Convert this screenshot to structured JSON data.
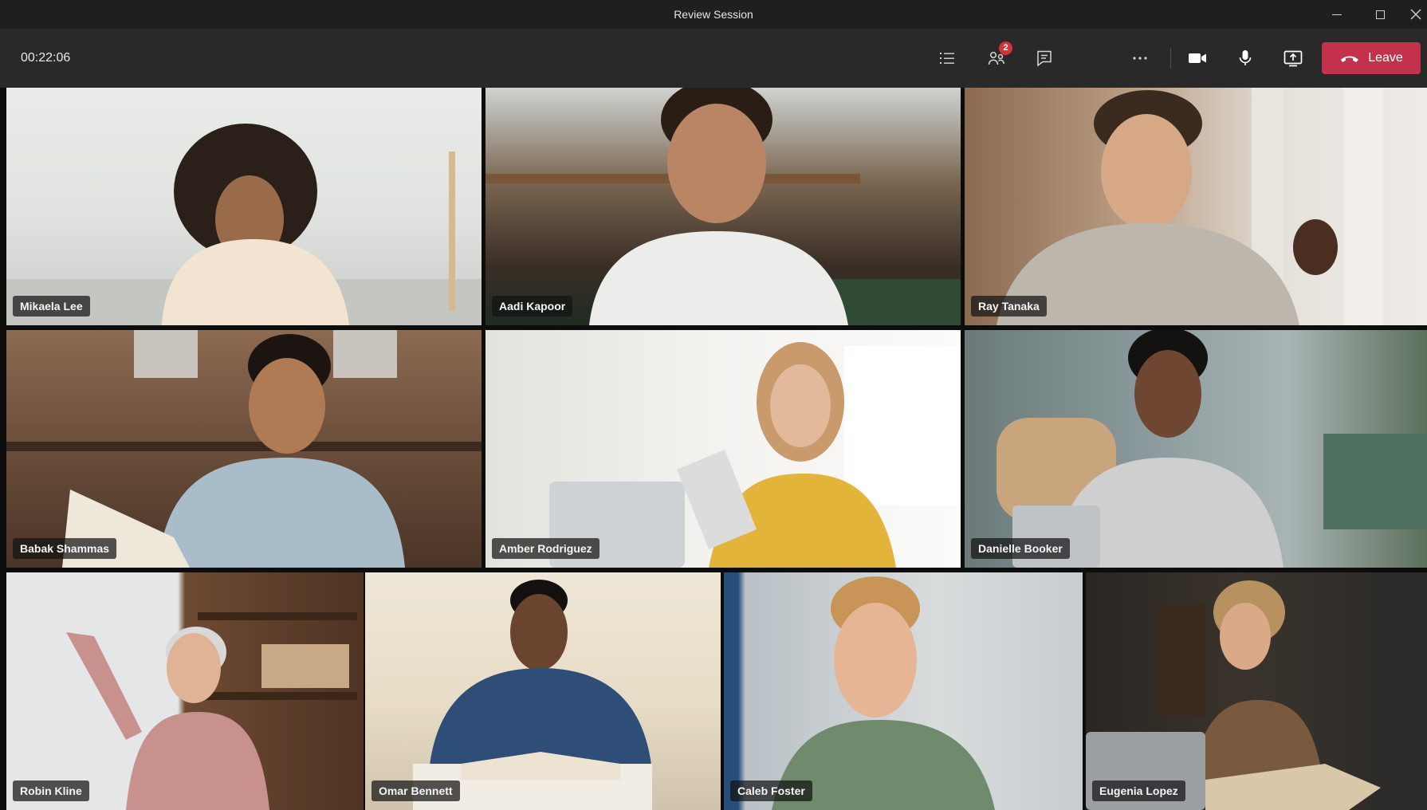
{
  "window": {
    "title": "Review Session"
  },
  "toolbar": {
    "timer": "00:22:06",
    "participants_badge": "2",
    "leave_label": "Leave",
    "icons": [
      "list-icon",
      "people-icon",
      "chat-icon",
      "more-icon",
      "camera-icon",
      "microphone-icon",
      "share-screen-icon",
      "hang-up-icon"
    ]
  },
  "participants": [
    {
      "name": "Mikaela Lee"
    },
    {
      "name": "Aadi Kapoor"
    },
    {
      "name": "Ray Tanaka"
    },
    {
      "name": "Babak Shammas"
    },
    {
      "name": "Amber Rodriguez"
    },
    {
      "name": "Danielle Booker"
    },
    {
      "name": "Robin Kline"
    },
    {
      "name": "Omar Bennett"
    },
    {
      "name": "Caleb Foster"
    },
    {
      "name": "Eugenia Lopez"
    }
  ],
  "colors": {
    "leave": "#c4314b",
    "badge": "#d13438",
    "toolbar": "#292929",
    "titlebar": "#1f1f1f"
  }
}
